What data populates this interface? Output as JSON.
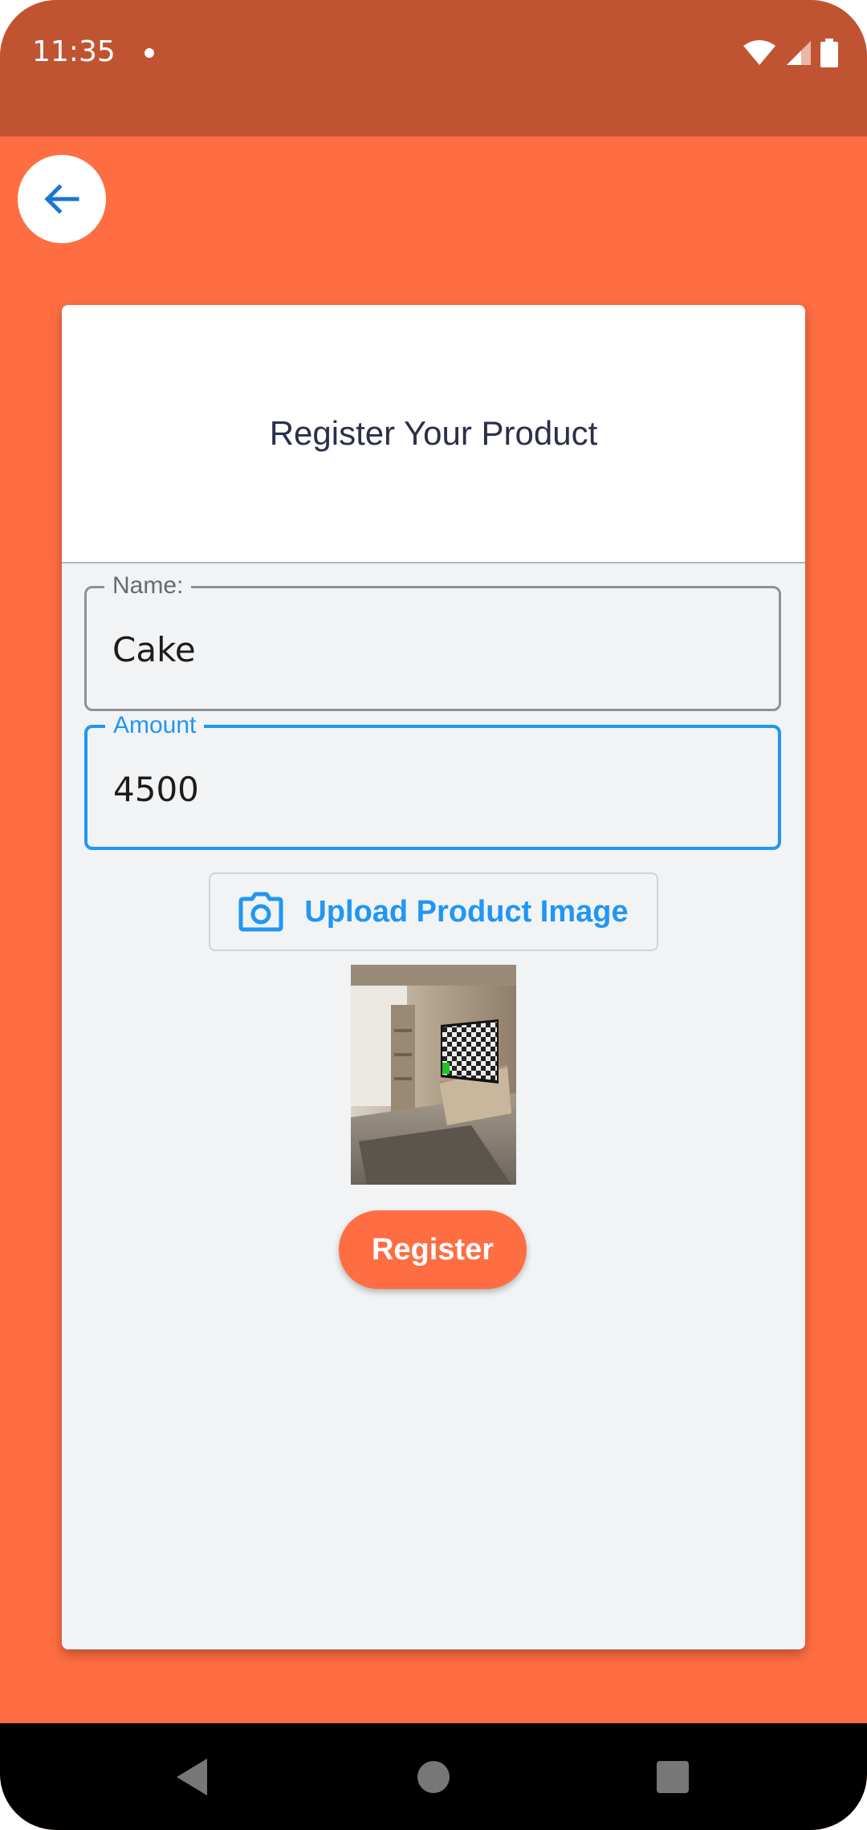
{
  "status_bar": {
    "time": "11:35"
  },
  "header": {
    "title": "Register Your Product"
  },
  "form": {
    "name_label": "Name:",
    "name_value": "Cake",
    "amount_label": "Amount",
    "amount_value": "4500"
  },
  "upload": {
    "label": "Upload Product Image",
    "icon": "camera-icon"
  },
  "register_label": "Register",
  "colors": {
    "background": "#FF6D42",
    "status_bar": "#C05432",
    "accent": "#2196F3",
    "card": "#F1F3F5",
    "title_text": "#2C2F4A"
  }
}
